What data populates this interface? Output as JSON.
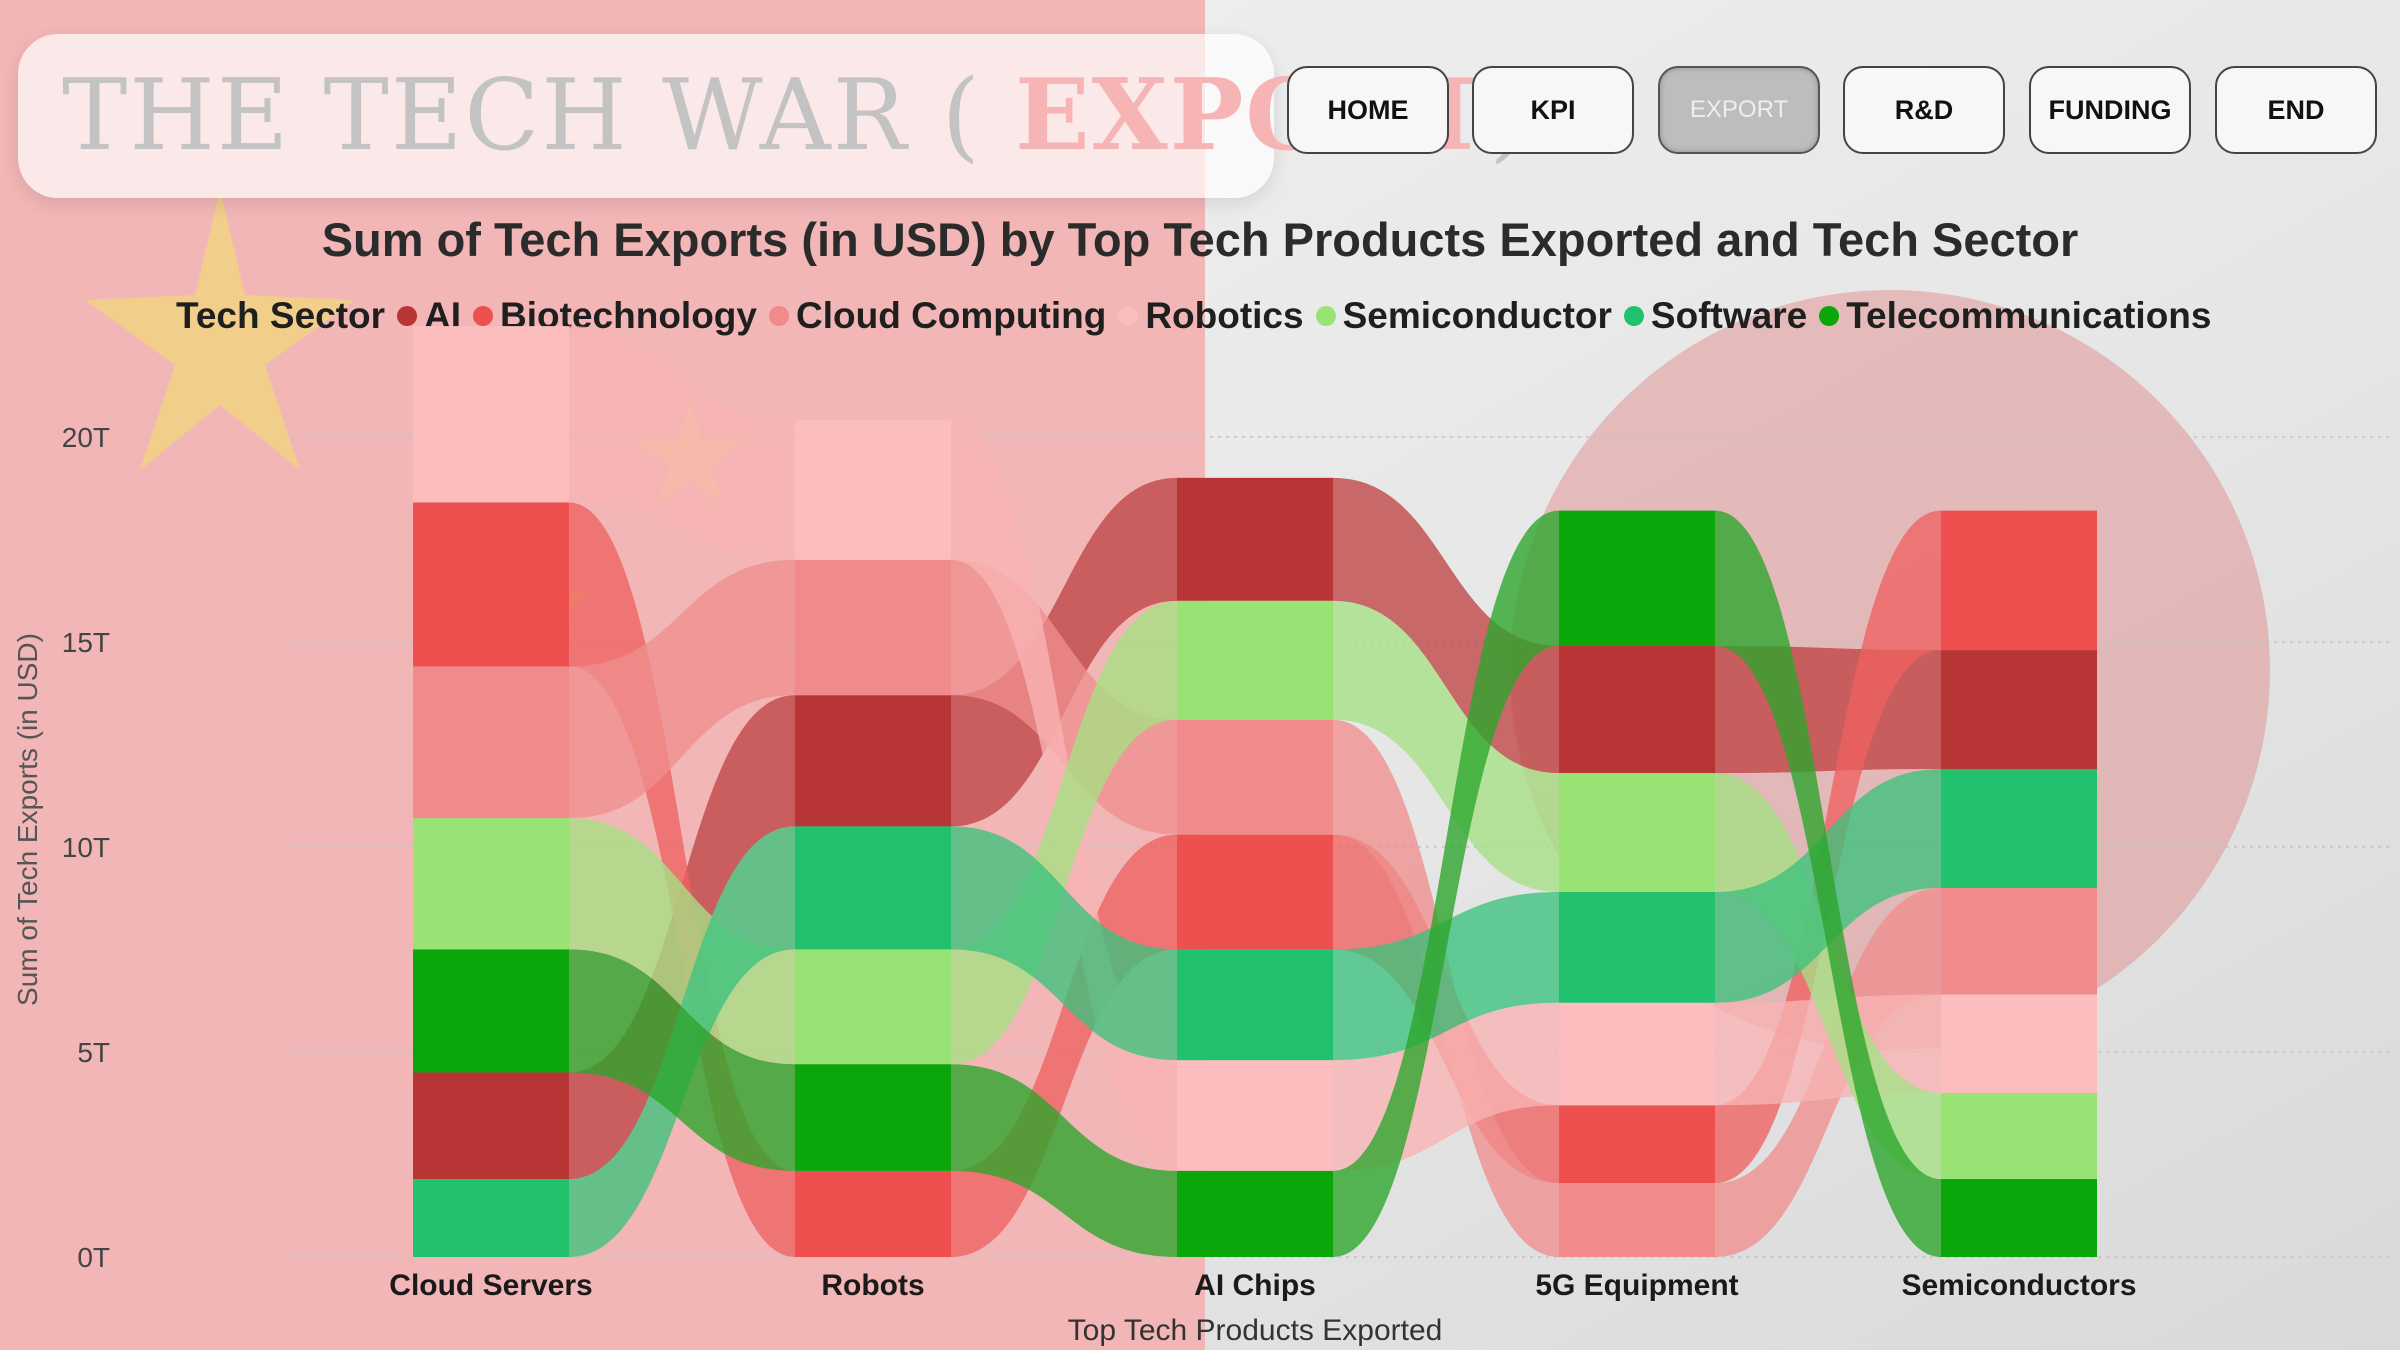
{
  "header": {
    "title_main": "THE TECH WAR ( ",
    "title_accent": "EXPORT",
    "title_end": ")"
  },
  "nav": {
    "home": "HOME",
    "kpi": "KPI",
    "export": "EXPORT",
    "rnd": "R&D",
    "funding": "FUNDING",
    "end": "END"
  },
  "legend": {
    "title": "Tech Sector"
  },
  "colors": {
    "flag_red": "#f0a8a8",
    "flag_star": "#f2d67c",
    "sun": "#e09494"
  },
  "chart_data": {
    "type": "ribbon",
    "title": "Sum of Tech Exports (in USD) by Top Tech Products Exported and Tech Sector",
    "xlabel": "Top Tech Products Exported",
    "ylabel": "Sum of Tech Exports (in USD)",
    "ylim": [
      0,
      22.8
    ],
    "yticks": [
      {
        "value": 0,
        "label": "0T"
      },
      {
        "value": 5,
        "label": "5T"
      },
      {
        "value": 10,
        "label": "10T"
      },
      {
        "value": 15,
        "label": "15T"
      },
      {
        "value": 20,
        "label": "20T"
      }
    ],
    "grid": true,
    "legend_position": "top-left",
    "categories": [
      "Cloud Servers",
      "Robots",
      "AI Chips",
      "5G Equipment",
      "Semiconductors"
    ],
    "series": [
      {
        "name": "AI",
        "color": "#b73535",
        "ribbon_color": "#bf4444",
        "values": [
          2.6,
          3.2,
          3.0,
          3.1,
          2.9
        ]
      },
      {
        "name": "Biotechnology",
        "color": "#ee4f4f",
        "ribbon_color": "#ee6262",
        "values": [
          4.0,
          2.1,
          2.8,
          1.9,
          3.4
        ]
      },
      {
        "name": "Cloud Computing",
        "color": "#f18b8b",
        "ribbon_color": "#f08e8e",
        "values": [
          3.7,
          3.3,
          2.8,
          1.8,
          2.6
        ]
      },
      {
        "name": "Robotics",
        "color": "#fbbdbd",
        "ribbon_color": "#f8b3b3",
        "values": [
          4.3,
          3.4,
          2.7,
          2.5,
          2.4
        ]
      },
      {
        "name": "Semiconductor",
        "color": "#98e373",
        "ribbon_color": "#a6e084",
        "values": [
          3.2,
          2.8,
          2.9,
          2.9,
          2.1
        ]
      },
      {
        "name": "Software",
        "color": "#22c16e",
        "ribbon_color": "#3cc27c",
        "values": [
          1.9,
          3.0,
          2.7,
          2.7,
          2.9
        ]
      },
      {
        "name": "Telecommunications",
        "color": "#0aa60a",
        "ribbon_color": "#2aa52a",
        "values": [
          3.0,
          2.6,
          2.1,
          3.3,
          1.9
        ]
      }
    ],
    "stack_order_bottom_to_top": [
      [
        "Software",
        "AI",
        "Telecommunications",
        "Semiconductor",
        "Cloud Computing",
        "Biotechnology",
        "Robotics"
      ],
      [
        "Biotechnology",
        "Telecommunications",
        "Semiconductor",
        "Software",
        "AI",
        "Cloud Computing",
        "Robotics"
      ],
      [
        "Telecommunications",
        "Robotics",
        "Software",
        "Biotechnology",
        "Cloud Computing",
        "Semiconductor",
        "AI"
      ],
      [
        "Cloud Computing",
        "Biotechnology",
        "Robotics",
        "Software",
        "Semiconductor",
        "AI",
        "Telecommunications"
      ],
      [
        "Telecommunications",
        "Semiconductor",
        "Robotics",
        "Cloud Computing",
        "Software",
        "AI",
        "Biotechnology"
      ]
    ]
  }
}
